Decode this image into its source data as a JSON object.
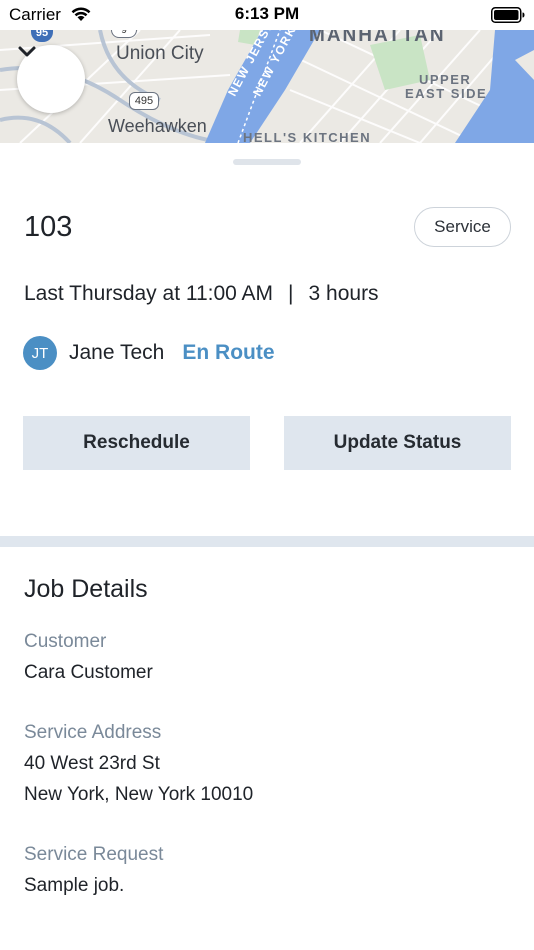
{
  "status_bar": {
    "carrier": "Carrier",
    "time": "6:13 PM"
  },
  "map": {
    "labels": {
      "union_city": "Union City",
      "manhattan": "MANHATTAN",
      "weehawken": "Weehawken",
      "upper": "UPPER",
      "east_side": "EAST SIDE",
      "hells_kitchen": "HELL'S KITCHEN",
      "new_jersey": "NEW JERSEY",
      "new_york": "NEW YORK",
      "route_495": "495",
      "route_95": "95",
      "route_9": "9"
    },
    "collapse_icon": "chevron-down-icon"
  },
  "job": {
    "number": "103",
    "type": "Service",
    "schedule_when": "Last Thursday at 11:00 AM",
    "schedule_separator": "|",
    "schedule_duration": "3 hours",
    "tech_initials": "JT",
    "tech_name": "Jane Tech",
    "tech_status": "En Route",
    "status_color": "#4b8fc4"
  },
  "actions": {
    "reschedule": "Reschedule",
    "update_status": "Update Status"
  },
  "details": {
    "title": "Job Details",
    "customer_label": "Customer",
    "customer_value": "Cara Customer",
    "address_label": "Service Address",
    "address_line1": "40 West 23rd St",
    "address_line2": "New York, New York 10010",
    "request_label": "Service Request",
    "request_value": "Sample job."
  }
}
